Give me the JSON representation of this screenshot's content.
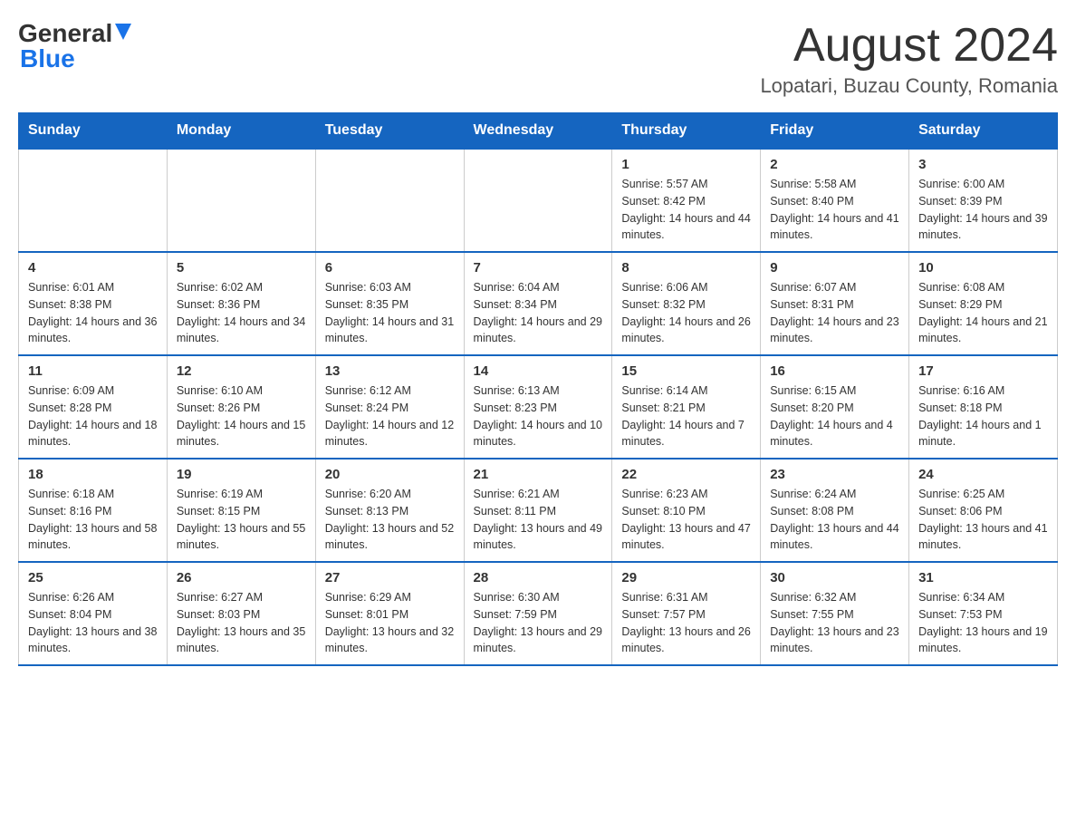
{
  "logo": {
    "general": "General",
    "arrow": "▶",
    "blue": "Blue"
  },
  "header": {
    "month_year": "August 2024",
    "location": "Lopatari, Buzau County, Romania"
  },
  "days_of_week": [
    "Sunday",
    "Monday",
    "Tuesday",
    "Wednesday",
    "Thursday",
    "Friday",
    "Saturday"
  ],
  "weeks": [
    [
      {
        "day": "",
        "sunrise": "",
        "sunset": "",
        "daylight": ""
      },
      {
        "day": "",
        "sunrise": "",
        "sunset": "",
        "daylight": ""
      },
      {
        "day": "",
        "sunrise": "",
        "sunset": "",
        "daylight": ""
      },
      {
        "day": "",
        "sunrise": "",
        "sunset": "",
        "daylight": ""
      },
      {
        "day": "1",
        "sunrise": "Sunrise: 5:57 AM",
        "sunset": "Sunset: 8:42 PM",
        "daylight": "Daylight: 14 hours and 44 minutes."
      },
      {
        "day": "2",
        "sunrise": "Sunrise: 5:58 AM",
        "sunset": "Sunset: 8:40 PM",
        "daylight": "Daylight: 14 hours and 41 minutes."
      },
      {
        "day": "3",
        "sunrise": "Sunrise: 6:00 AM",
        "sunset": "Sunset: 8:39 PM",
        "daylight": "Daylight: 14 hours and 39 minutes."
      }
    ],
    [
      {
        "day": "4",
        "sunrise": "Sunrise: 6:01 AM",
        "sunset": "Sunset: 8:38 PM",
        "daylight": "Daylight: 14 hours and 36 minutes."
      },
      {
        "day": "5",
        "sunrise": "Sunrise: 6:02 AM",
        "sunset": "Sunset: 8:36 PM",
        "daylight": "Daylight: 14 hours and 34 minutes."
      },
      {
        "day": "6",
        "sunrise": "Sunrise: 6:03 AM",
        "sunset": "Sunset: 8:35 PM",
        "daylight": "Daylight: 14 hours and 31 minutes."
      },
      {
        "day": "7",
        "sunrise": "Sunrise: 6:04 AM",
        "sunset": "Sunset: 8:34 PM",
        "daylight": "Daylight: 14 hours and 29 minutes."
      },
      {
        "day": "8",
        "sunrise": "Sunrise: 6:06 AM",
        "sunset": "Sunset: 8:32 PM",
        "daylight": "Daylight: 14 hours and 26 minutes."
      },
      {
        "day": "9",
        "sunrise": "Sunrise: 6:07 AM",
        "sunset": "Sunset: 8:31 PM",
        "daylight": "Daylight: 14 hours and 23 minutes."
      },
      {
        "day": "10",
        "sunrise": "Sunrise: 6:08 AM",
        "sunset": "Sunset: 8:29 PM",
        "daylight": "Daylight: 14 hours and 21 minutes."
      }
    ],
    [
      {
        "day": "11",
        "sunrise": "Sunrise: 6:09 AM",
        "sunset": "Sunset: 8:28 PM",
        "daylight": "Daylight: 14 hours and 18 minutes."
      },
      {
        "day": "12",
        "sunrise": "Sunrise: 6:10 AM",
        "sunset": "Sunset: 8:26 PM",
        "daylight": "Daylight: 14 hours and 15 minutes."
      },
      {
        "day": "13",
        "sunrise": "Sunrise: 6:12 AM",
        "sunset": "Sunset: 8:24 PM",
        "daylight": "Daylight: 14 hours and 12 minutes."
      },
      {
        "day": "14",
        "sunrise": "Sunrise: 6:13 AM",
        "sunset": "Sunset: 8:23 PM",
        "daylight": "Daylight: 14 hours and 10 minutes."
      },
      {
        "day": "15",
        "sunrise": "Sunrise: 6:14 AM",
        "sunset": "Sunset: 8:21 PM",
        "daylight": "Daylight: 14 hours and 7 minutes."
      },
      {
        "day": "16",
        "sunrise": "Sunrise: 6:15 AM",
        "sunset": "Sunset: 8:20 PM",
        "daylight": "Daylight: 14 hours and 4 minutes."
      },
      {
        "day": "17",
        "sunrise": "Sunrise: 6:16 AM",
        "sunset": "Sunset: 8:18 PM",
        "daylight": "Daylight: 14 hours and 1 minute."
      }
    ],
    [
      {
        "day": "18",
        "sunrise": "Sunrise: 6:18 AM",
        "sunset": "Sunset: 8:16 PM",
        "daylight": "Daylight: 13 hours and 58 minutes."
      },
      {
        "day": "19",
        "sunrise": "Sunrise: 6:19 AM",
        "sunset": "Sunset: 8:15 PM",
        "daylight": "Daylight: 13 hours and 55 minutes."
      },
      {
        "day": "20",
        "sunrise": "Sunrise: 6:20 AM",
        "sunset": "Sunset: 8:13 PM",
        "daylight": "Daylight: 13 hours and 52 minutes."
      },
      {
        "day": "21",
        "sunrise": "Sunrise: 6:21 AM",
        "sunset": "Sunset: 8:11 PM",
        "daylight": "Daylight: 13 hours and 49 minutes."
      },
      {
        "day": "22",
        "sunrise": "Sunrise: 6:23 AM",
        "sunset": "Sunset: 8:10 PM",
        "daylight": "Daylight: 13 hours and 47 minutes."
      },
      {
        "day": "23",
        "sunrise": "Sunrise: 6:24 AM",
        "sunset": "Sunset: 8:08 PM",
        "daylight": "Daylight: 13 hours and 44 minutes."
      },
      {
        "day": "24",
        "sunrise": "Sunrise: 6:25 AM",
        "sunset": "Sunset: 8:06 PM",
        "daylight": "Daylight: 13 hours and 41 minutes."
      }
    ],
    [
      {
        "day": "25",
        "sunrise": "Sunrise: 6:26 AM",
        "sunset": "Sunset: 8:04 PM",
        "daylight": "Daylight: 13 hours and 38 minutes."
      },
      {
        "day": "26",
        "sunrise": "Sunrise: 6:27 AM",
        "sunset": "Sunset: 8:03 PM",
        "daylight": "Daylight: 13 hours and 35 minutes."
      },
      {
        "day": "27",
        "sunrise": "Sunrise: 6:29 AM",
        "sunset": "Sunset: 8:01 PM",
        "daylight": "Daylight: 13 hours and 32 minutes."
      },
      {
        "day": "28",
        "sunrise": "Sunrise: 6:30 AM",
        "sunset": "Sunset: 7:59 PM",
        "daylight": "Daylight: 13 hours and 29 minutes."
      },
      {
        "day": "29",
        "sunrise": "Sunrise: 6:31 AM",
        "sunset": "Sunset: 7:57 PM",
        "daylight": "Daylight: 13 hours and 26 minutes."
      },
      {
        "day": "30",
        "sunrise": "Sunrise: 6:32 AM",
        "sunset": "Sunset: 7:55 PM",
        "daylight": "Daylight: 13 hours and 23 minutes."
      },
      {
        "day": "31",
        "sunrise": "Sunrise: 6:34 AM",
        "sunset": "Sunset: 7:53 PM",
        "daylight": "Daylight: 13 hours and 19 minutes."
      }
    ]
  ]
}
